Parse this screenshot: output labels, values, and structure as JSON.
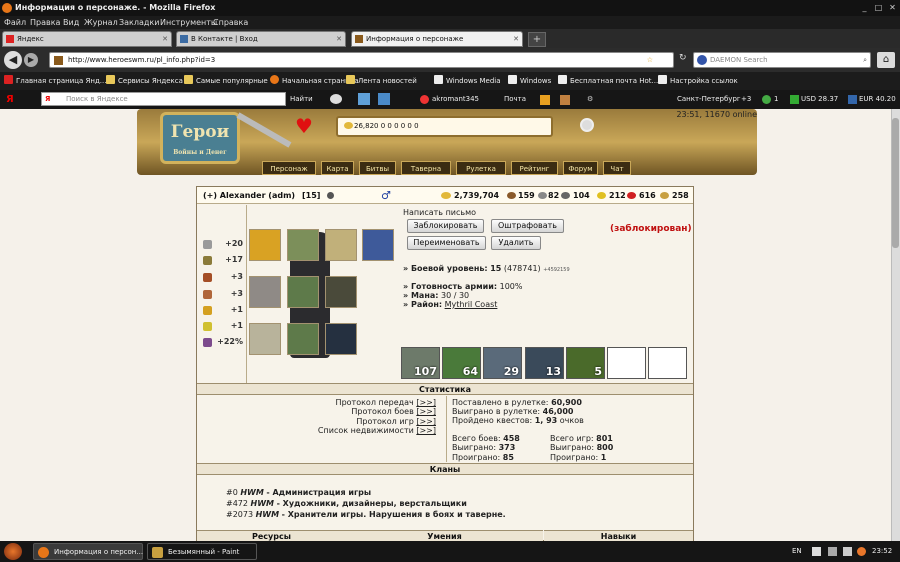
{
  "window": {
    "title": "Информация о персонаже. - Mozilla Firefox"
  },
  "menu": [
    "Файл",
    "Правка",
    "Вид",
    "Журнал",
    "Закладки",
    "Инструменты",
    "Справка"
  ],
  "tabs": [
    {
      "label": "Яндекс"
    },
    {
      "label": "В Контакте | Вход"
    },
    {
      "label": "Информация о персонаже"
    }
  ],
  "address": {
    "url": "http://www.heroeswm.ru/pl_info.php?id=3"
  },
  "search": {
    "placeholder": "DAEMON Search"
  },
  "bookmarks": [
    "Главная страница Янд...",
    "Сервисы Яндекса",
    "Самые популярные",
    "Начальная страница",
    "Лента новостей",
    "Windows Media",
    "Windows",
    "Бесплатная почта Hot...",
    "Настройка ссылок"
  ],
  "yandex_bar": {
    "search_placeholder": "Поиск в Яндексе",
    "find": "Найти",
    "user": "akromant345",
    "mail": "Почта",
    "city": "Санкт-Петербург",
    "temp": "+3",
    "mail_count": "1",
    "usd": "USD 28.37",
    "eur": "EUR 40.20"
  },
  "game": {
    "logo": "Герои",
    "logo_sub": "Войны и Денег",
    "time": "23:51, 11670 online",
    "resources": "26,820  0  0  0  0  0  0",
    "nav": [
      "Персонаж",
      "Карта",
      "Битвы",
      "Таверна",
      "Рулетка",
      "Рейтинг",
      "Форум",
      "Чат"
    ]
  },
  "player": {
    "header": "(+) Alexander (adm)",
    "level": "[15]",
    "gender": "♂",
    "gold": "2,739,704",
    "r1": "159",
    "r2": "82",
    "r3": "104",
    "r4": "212",
    "r5": "616",
    "r6": "258",
    "stats": [
      {
        "value": "+20",
        "color": "#9a9a9a"
      },
      {
        "value": "+17",
        "color": "#8b7b3a"
      },
      {
        "value": "+3",
        "color": "#a44e26"
      },
      {
        "value": "+3",
        "color": "#b0663a"
      },
      {
        "value": "+1",
        "color": "#d4a020"
      },
      {
        "value": "+1",
        "color": "#d0c030"
      },
      {
        "value": "+22%",
        "color": "#7c4a8c"
      }
    ],
    "write_letter": "Написать письмо",
    "buttons": {
      "block": "Заблокировать",
      "fine": "Оштрафовать",
      "rename": "Переименовать",
      "delete": "Удалить"
    },
    "blocked": "(заблокирован)",
    "combat_label": "» Боевой уровень:",
    "combat_value": "15",
    "combat_exp": "(478741)",
    "combat_plus": "+4592159",
    "army_ready_label": "» Готовность армии:",
    "army_ready_value": "100%",
    "mana_label": "» Мана:",
    "mana_value": "30 / 30",
    "district_label": "» Район:",
    "district_value": "Mythril Coast",
    "army": [
      "107",
      "64",
      "29",
      "13",
      "5",
      "",
      ""
    ]
  },
  "statistics": {
    "title": "Статистика",
    "links": [
      "Протокол передач",
      "Протокол боев",
      "Протокол игр",
      "Список недвижимости"
    ],
    "link_btn": "[>>]",
    "roulette_bet_label": "Поставлено в рулетке:",
    "roulette_bet": "60,900",
    "roulette_won_label": "Выиграно в рулетке:",
    "roulette_won": "46,000",
    "quests_label": "Пройдено квестов:",
    "quests": "1, 93",
    "quests_unit": "очков",
    "battles_label": "Всего боев:",
    "battles": "458",
    "won_label": "Выиграно:",
    "won": "373",
    "lost_label": "Проиграно:",
    "lost": "85",
    "games_label": "Всего игр:",
    "games": "801",
    "games_won": "800",
    "games_lost": "1"
  },
  "clans": {
    "title": "Кланы",
    "list": [
      {
        "id": "#0",
        "tag": "HWM",
        "name": "- Администрация игры"
      },
      {
        "id": "#472",
        "tag": "HWM",
        "name": "- Художники, дизайнеры, верстальщики"
      },
      {
        "id": "#2073",
        "tag": "HWM",
        "name": "- Хранители игры. Нарушения в боях и таверне."
      }
    ]
  },
  "bottom_tabs": [
    "Ресурсы",
    "Умения",
    "Навыки"
  ],
  "taskbar": {
    "items": [
      "Информация о персон...",
      "Безымянный - Paint"
    ],
    "lang": "EN",
    "time": "23:52"
  }
}
